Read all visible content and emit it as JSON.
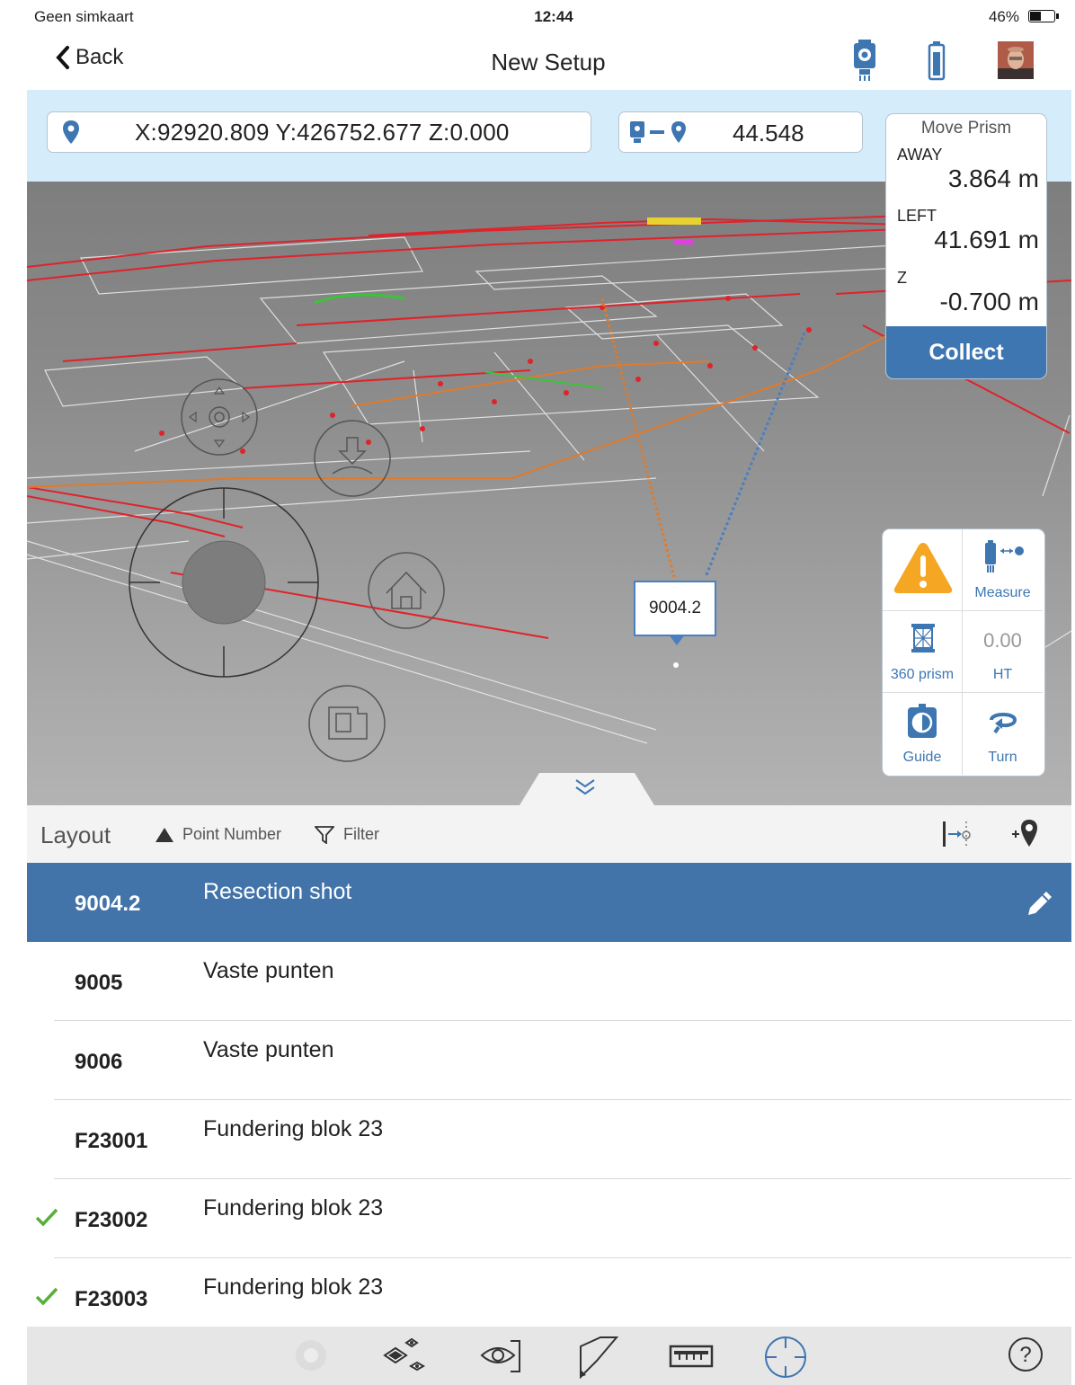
{
  "status_bar": {
    "carrier": "Geen simkaart",
    "time": "12:44",
    "battery": "46%"
  },
  "nav": {
    "back_label": "Back",
    "title": "New Setup"
  },
  "coordinates": {
    "text": "X:92920.809   Y:426752.677   Z:0.000",
    "distance": "44.548"
  },
  "move_prism": {
    "title": "Move Prism",
    "away_label": "AWAY",
    "away_value": "3.864 m",
    "left_label": "LEFT",
    "left_value": "41.691 m",
    "z_label": "Z",
    "z_value": "-0.700 m",
    "collect_label": "Collect"
  },
  "tools": {
    "measure_label": "Measure",
    "prism_label": "360 prism",
    "ht_value": "0.00",
    "ht_label": "HT",
    "guide_label": "Guide",
    "turn_label": "Turn"
  },
  "callout": {
    "label": "9004.2"
  },
  "layout": {
    "title": "Layout",
    "sort_label": "Point Number",
    "filter_label": "Filter"
  },
  "points": [
    {
      "id": "9004.2",
      "desc": "Resection shot",
      "selected": true,
      "checked": false
    },
    {
      "id": "9005",
      "desc": "Vaste punten",
      "selected": false,
      "checked": false
    },
    {
      "id": "9006",
      "desc": "Vaste punten",
      "selected": false,
      "checked": false
    },
    {
      "id": "F23001",
      "desc": "Fundering blok 23",
      "selected": false,
      "checked": false
    },
    {
      "id": "F23002",
      "desc": "Fundering blok 23",
      "selected": false,
      "checked": true
    },
    {
      "id": "F23003",
      "desc": "Fundering blok 23",
      "selected": false,
      "checked": true
    }
  ],
  "colors": {
    "accent": "#3e76b2",
    "selected_row": "#4274aa",
    "coord_bar": "#d5ecfb",
    "warning": "#f5a623",
    "check": "#5aae3a"
  },
  "icons": [
    "back-chevron-icon",
    "instrument-icon",
    "battery-icon",
    "avatar",
    "location-pin-icon",
    "instrument-to-point-icon",
    "warning-icon",
    "measure-icon",
    "prism-icon",
    "guide-icon",
    "turn-icon",
    "chevron-down-double-icon",
    "sort-up-icon",
    "filter-icon",
    "stakeout-icon",
    "add-point-icon",
    "pencil-icon",
    "checkmark-icon",
    "selector-icon",
    "layers-icon",
    "visibility-icon",
    "draw-icon",
    "ruler-icon",
    "crosshair-icon",
    "help-icon"
  ]
}
